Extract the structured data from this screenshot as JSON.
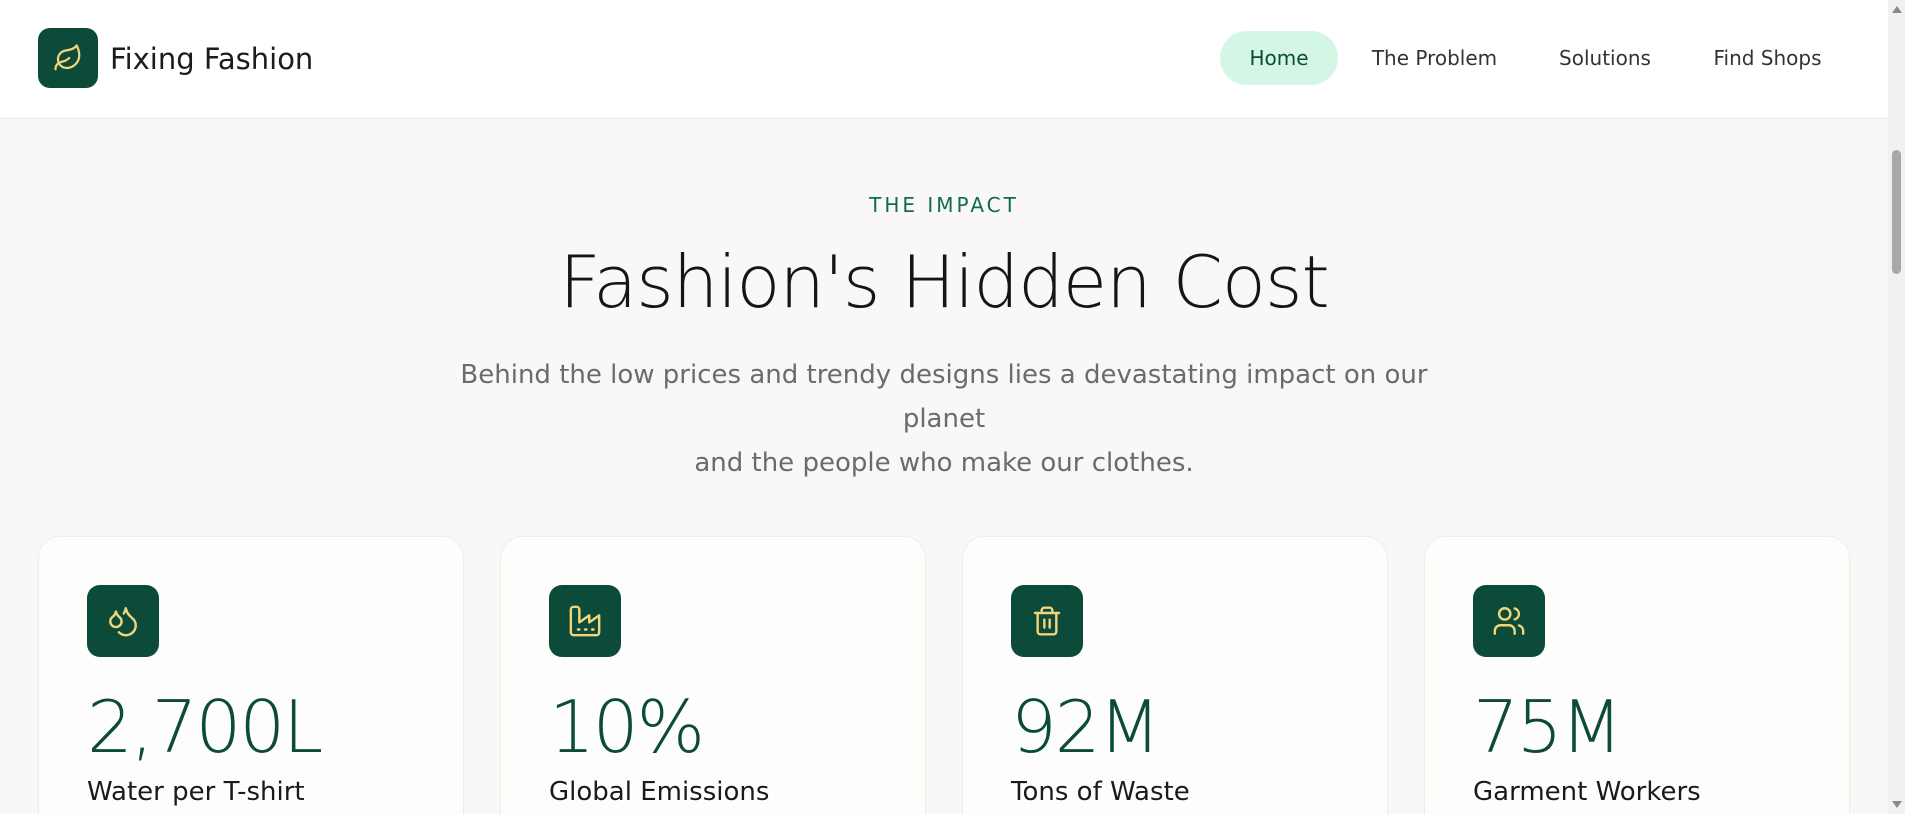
{
  "brand": {
    "name": "Fixing Fashion",
    "icon": "leaf-icon",
    "color": "#0c4a3a",
    "accent": "#f2d47a"
  },
  "nav": {
    "items": [
      {
        "label": "Home",
        "active": true
      },
      {
        "label": "The Problem",
        "active": false
      },
      {
        "label": "Solutions",
        "active": false
      },
      {
        "label": "Find Shops",
        "active": false
      }
    ]
  },
  "hero": {
    "eyebrow": "THE IMPACT",
    "title": "Fashion's Hidden Cost",
    "subtitle_line1": "Behind the low prices and trendy designs lies a devastating impact on our planet",
    "subtitle_line2": "and the people who make our clothes."
  },
  "stats": [
    {
      "value": "2,700L",
      "label": "Water per T-shirt",
      "icon": "water-drops-icon"
    },
    {
      "value": "10%",
      "label": "Global Emissions",
      "icon": "factory-icon"
    },
    {
      "value": "92M",
      "label": "Tons of Waste",
      "icon": "trash-icon"
    },
    {
      "value": "75M",
      "label": "Garment Workers",
      "icon": "users-icon"
    }
  ],
  "colors": {
    "active_nav_bg": "#d4f7e5",
    "eyebrow": "#0f6b52",
    "page_bg": "#f9f8f6"
  }
}
